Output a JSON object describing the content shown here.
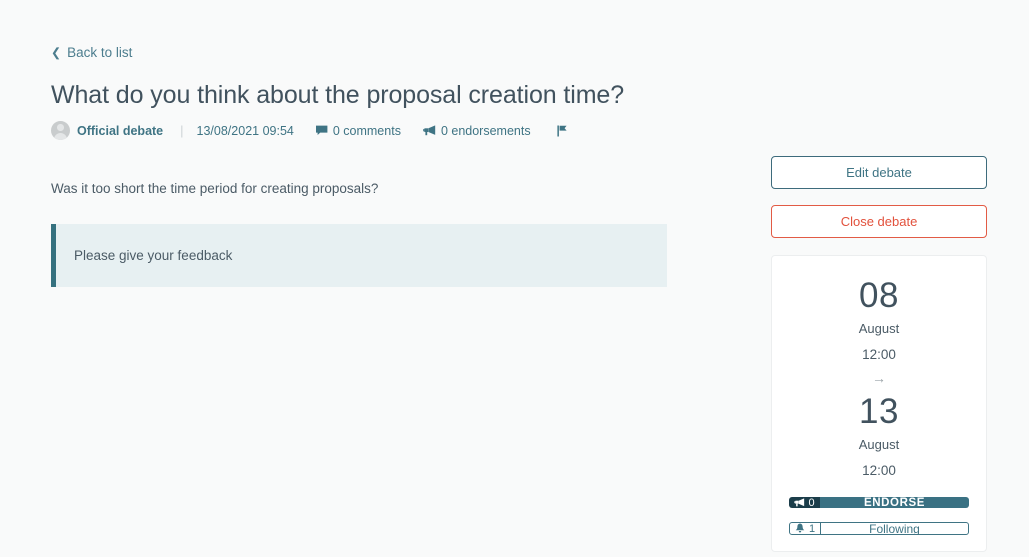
{
  "colors": {
    "page_background": "#f9fafa",
    "teal": "#3f7484",
    "teal_dark": "#1b3d4a",
    "teal_button": "#3a7183",
    "red": "#e2513c",
    "callout_background": "#e7f0f2",
    "callout_border": "#35717f",
    "title": "#41525e"
  },
  "back_link": {
    "label": "Back to list",
    "icon": "chevron-left-icon"
  },
  "debate": {
    "title": "What do you think about the proposal creation time?",
    "author": "Official debate",
    "avatar_icon": "user-avatar-icon",
    "separator": "|",
    "date": "13/08/2021 09:54",
    "comments": {
      "label": "0 comments",
      "icon": "comment-icon",
      "count": 0
    },
    "endorsements": {
      "label": "0 endorsements",
      "icon": "megaphone-icon",
      "count": 0
    },
    "flag": {
      "icon": "flag-icon",
      "label": ""
    },
    "description": "Was it too short the time period for creating proposals?",
    "callout": "Please give your feedback"
  },
  "sidebar": {
    "edit_button": "Edit debate",
    "close_button": "Close debate",
    "schedule": {
      "start": {
        "day": "08",
        "month": "August",
        "time": "12:00"
      },
      "arrow": "→",
      "end": {
        "day": "13",
        "month": "August",
        "time": "12:00"
      }
    },
    "endorse": {
      "count": "0",
      "count_icon": "megaphone-icon",
      "label": "ENDORSE"
    },
    "follow": {
      "count": "1",
      "count_icon": "bell-icon",
      "label": "Following"
    }
  }
}
